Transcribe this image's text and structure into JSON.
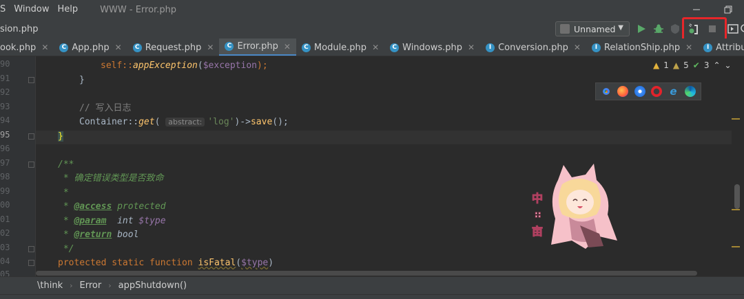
{
  "menubar": {
    "items": [
      "S",
      "Window",
      "Help"
    ],
    "title": "WWW - Error.php"
  },
  "toolbar": {
    "breadcrumb": "sion.php",
    "run_config": "Unnamed"
  },
  "tabs": [
    {
      "label": "ook.php",
      "icon": "php-file-icon",
      "active": false
    },
    {
      "label": "App.php",
      "icon": "php-class-icon",
      "active": false
    },
    {
      "label": "Request.php",
      "icon": "php-class-icon",
      "active": false
    },
    {
      "label": "Error.php",
      "icon": "php-class-icon",
      "active": true
    },
    {
      "label": "Module.php",
      "icon": "php-class-icon",
      "active": false
    },
    {
      "label": "Windows.php",
      "icon": "php-class-icon",
      "active": false
    },
    {
      "label": "Conversion.php",
      "icon": "php-interface-icon",
      "active": false
    },
    {
      "label": "RelationShip.php",
      "icon": "php-interface-icon",
      "active": false
    },
    {
      "label": "Attribute.php",
      "icon": "php-interface-icon",
      "active": false
    }
  ],
  "inspections": {
    "warnings": "1",
    "weak_warnings": "5",
    "ok": "3"
  },
  "line_numbers": [
    "90",
    "91",
    "92",
    "93",
    "94",
    "95",
    "96",
    "97",
    "98",
    "99",
    "00",
    "01",
    "02",
    "03",
    "04",
    "05"
  ],
  "code": {
    "l90_self": "self::",
    "l90_fn": "appException",
    "l90_var": "$exception",
    "l91": "}",
    "l93_comment": "// 写入日志",
    "l94_container": "Container::",
    "l94_fn": "get",
    "l94_hint": "abstract:",
    "l94_str": "'log'",
    "l94_save": "save",
    "l95": "}",
    "l97": "/**",
    "l98": " * 确定错误类型是否致命",
    "l99": " *",
    "l00_tag": "@access",
    "l00_rest": " protected",
    "l01_tag": "@param",
    "l01_type": "  int ",
    "l01_var": "$type",
    "l02_tag": "@return",
    "l02_rest": " bool",
    "l03": " */",
    "l04_kw": "protected static function ",
    "l04_fn": "isFatal",
    "l04_var": "$type"
  },
  "breadcrumbs": [
    "\\think",
    "Error",
    "appShutdown()"
  ],
  "colors": {
    "highlight": "#e8262a",
    "accent": "#4a88c7"
  }
}
